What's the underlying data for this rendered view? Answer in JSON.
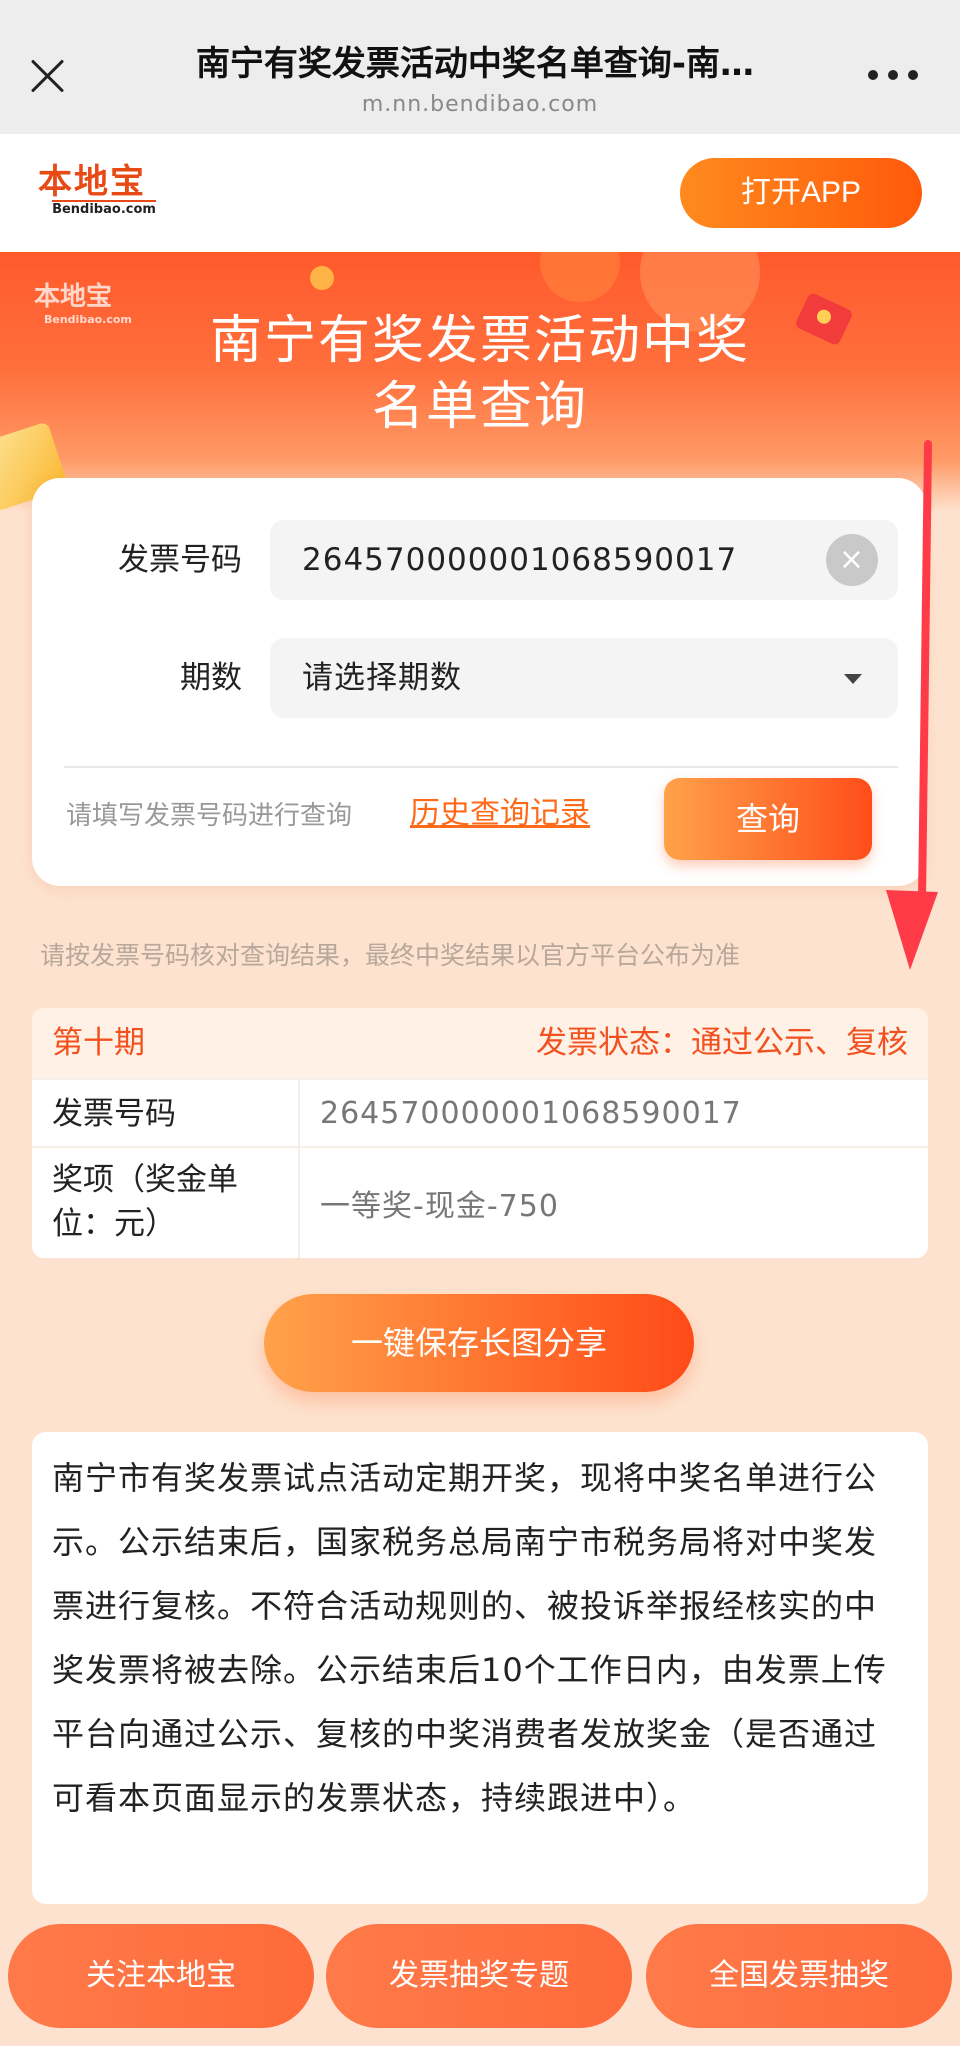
{
  "browser": {
    "title": "南宁有奖发票活动中奖名单查询-南…",
    "url": "m.nn.bendibao.com"
  },
  "appbar": {
    "logo_cn": "本地宝",
    "logo_en": "Bendibao.com",
    "open_app_label": "打开APP"
  },
  "hero": {
    "logo_cn": "本地宝",
    "logo_en": "Bendibao.com",
    "title_line1": "南宁有奖发票活动中奖",
    "title_line2": "名单查询"
  },
  "form": {
    "invoice_label": "发票号码",
    "invoice_value": "264570000001068590017",
    "clear_glyph": "×",
    "period_label": "期数",
    "period_placeholder": "请选择期数",
    "hint": "请填写发票号码进行查询",
    "history_link": "历史查询记录",
    "query_label": "查询"
  },
  "notice": "请按发票号码核对查询结果，最终中奖结果以官方平台公布为准",
  "result": {
    "period": "第十期",
    "status": "发票状态：通过公示、复核",
    "rows": [
      {
        "key": "发票号码",
        "value": "264570000001068590017"
      },
      {
        "key": "奖项（奖金单位：元）",
        "value": "一等奖-现金-750"
      }
    ]
  },
  "share_label": "一键保存长图分享",
  "description": "南宁市有奖发票试点活动定期开奖，现将中奖名单进行公示。公示结束后，国家税务总局南宁市税务局将对中奖发票进行复核。不符合活动规则的、被投诉举报经核实的中奖发票将被去除。公示结束后10个工作日内，由发票上传平台向通过公示、复核的中奖消费者发放奖金（是否通过可看本页面显示的发票状态，持续跟进中）。",
  "bottom_nav": [
    "关注本地宝",
    "发票抽奖专题",
    "全国发票抽奖"
  ],
  "colors": {
    "accent": "#ff5a0a",
    "highlight_text": "#f2511f",
    "page_bg": "#fde3cf",
    "annotation_arrow": "#ff3b47"
  }
}
